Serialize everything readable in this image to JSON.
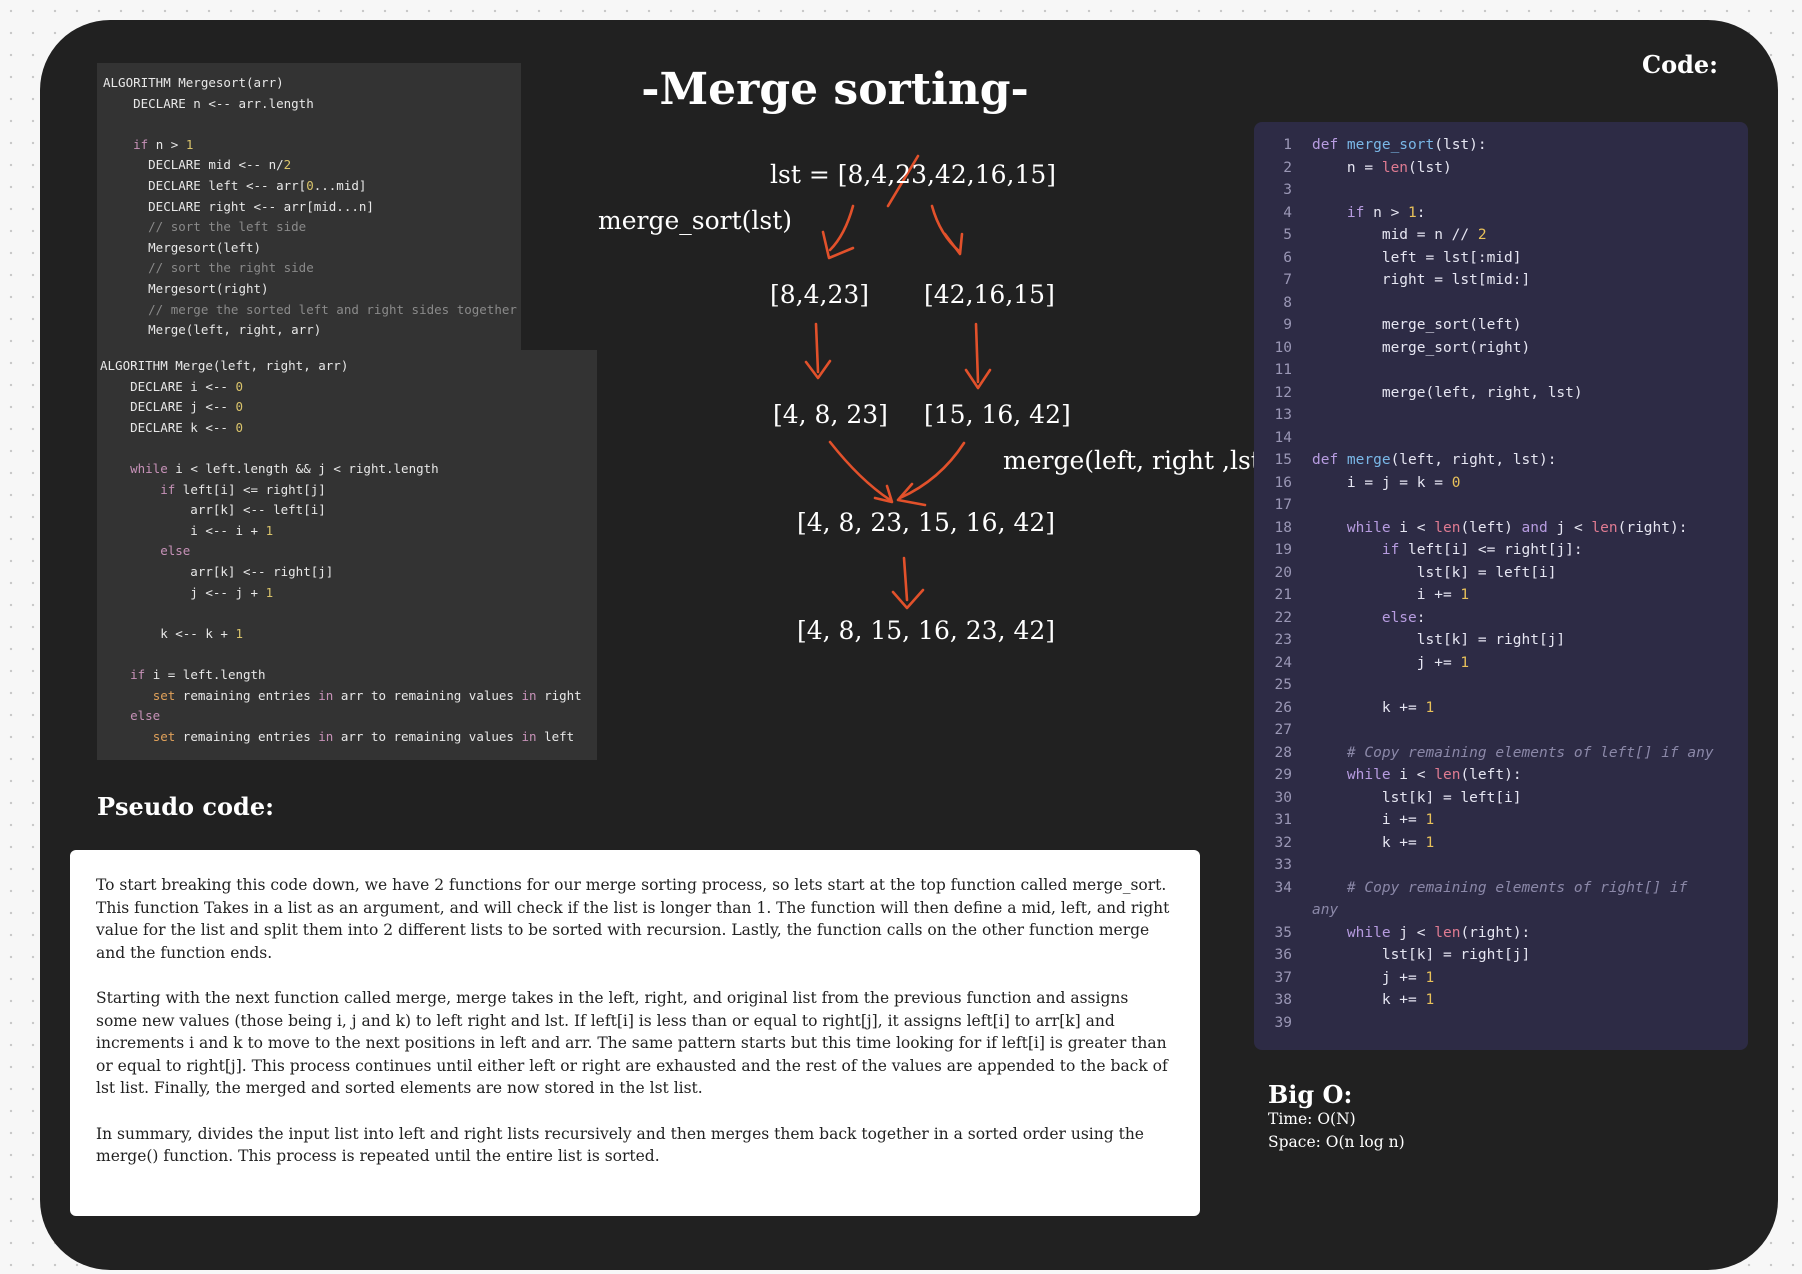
{
  "page": {
    "title": "-Merge sorting-",
    "code_heading": "Code:",
    "pseudo_heading": "Pseudo code:"
  },
  "diagram": {
    "root": "lst = [8,4,23,42,16,15]",
    "merge_sort_label": "merge_sort(lst)",
    "split_left": "[8,4,23]",
    "split_right": "[42,16,15]",
    "sorted_left": "[4, 8, 23]",
    "sorted_right": "[15, 16, 42]",
    "merge_label": "merge(left, right ,lst)",
    "combined": "[4, 8, 23, 15, 16, 42]",
    "result": "[4, 8, 15, 16, 23, 42]",
    "arrow_color": "#e2512b"
  },
  "pseudo_mergesort": [
    [
      [
        "t",
        "ALGORITHM Mergesort(arr)"
      ]
    ],
    [
      [
        "t",
        "    DECLARE n <-- arr.length"
      ]
    ],
    [
      [
        "t",
        ""
      ]
    ],
    [
      [
        "t",
        "    "
      ],
      [
        "kw",
        "if"
      ],
      [
        "t",
        " n > "
      ],
      [
        "num",
        "1"
      ]
    ],
    [
      [
        "t",
        "      DECLARE mid <-- n/"
      ],
      [
        "num",
        "2"
      ]
    ],
    [
      [
        "t",
        "      DECLARE left <-- arr["
      ],
      [
        "num",
        "0"
      ],
      [
        "t",
        "...mid]"
      ]
    ],
    [
      [
        "t",
        "      DECLARE right <-- arr[mid...n]"
      ]
    ],
    [
      [
        "cm",
        "      // sort the left side"
      ]
    ],
    [
      [
        "t",
        "      Mergesort(left)"
      ]
    ],
    [
      [
        "cm",
        "      // sort the right side"
      ]
    ],
    [
      [
        "t",
        "      Mergesort(right)"
      ]
    ],
    [
      [
        "cm",
        "      // merge the sorted left and right sides together"
      ]
    ],
    [
      [
        "t",
        "      Merge(left, right, arr)"
      ]
    ]
  ],
  "pseudo_merge": [
    [
      [
        "t",
        "ALGORITHM Merge(left, right, arr)"
      ]
    ],
    [
      [
        "t",
        "    DECLARE i <-- "
      ],
      [
        "num",
        "0"
      ]
    ],
    [
      [
        "t",
        "    DECLARE j <-- "
      ],
      [
        "num",
        "0"
      ]
    ],
    [
      [
        "t",
        "    DECLARE k <-- "
      ],
      [
        "num",
        "0"
      ]
    ],
    [
      [
        "t",
        ""
      ]
    ],
    [
      [
        "t",
        "    "
      ],
      [
        "kw",
        "while"
      ],
      [
        "t",
        " i < left.length && j < right.length"
      ]
    ],
    [
      [
        "t",
        "        "
      ],
      [
        "kw",
        "if"
      ],
      [
        "t",
        " left[i] <= right[j]"
      ]
    ],
    [
      [
        "t",
        "            arr[k] <-- left[i]"
      ]
    ],
    [
      [
        "t",
        "            i <-- i + "
      ],
      [
        "num",
        "1"
      ]
    ],
    [
      [
        "t",
        "        "
      ],
      [
        "kw",
        "else"
      ]
    ],
    [
      [
        "t",
        "            arr[k] <-- right[j]"
      ]
    ],
    [
      [
        "t",
        "            j <-- j + "
      ],
      [
        "num",
        "1"
      ]
    ],
    [
      [
        "t",
        ""
      ]
    ],
    [
      [
        "t",
        "        k <-- k + "
      ],
      [
        "num",
        "1"
      ]
    ],
    [
      [
        "t",
        ""
      ]
    ],
    [
      [
        "t",
        "    "
      ],
      [
        "kw",
        "if"
      ],
      [
        "t",
        " i = left.length"
      ]
    ],
    [
      [
        "t",
        "       "
      ],
      [
        "st",
        "set"
      ],
      [
        "t",
        " remaining entries "
      ],
      [
        "kw",
        "in"
      ],
      [
        "t",
        " arr to remaining values "
      ],
      [
        "kw",
        "in"
      ],
      [
        "t",
        " right"
      ]
    ],
    [
      [
        "t",
        "    "
      ],
      [
        "kw",
        "else"
      ]
    ],
    [
      [
        "t",
        "       "
      ],
      [
        "st",
        "set"
      ],
      [
        "t",
        " remaining entries "
      ],
      [
        "kw",
        "in"
      ],
      [
        "t",
        " arr to remaining values "
      ],
      [
        "kw",
        "in"
      ],
      [
        "t",
        " left"
      ]
    ]
  ],
  "explanation": [
    "To start breaking this code down, we have 2 functions for our merge sorting process, so lets start at the top function called merge_sort. This function Takes in a list as an argument, and will check if the list is longer than 1. The function will then define a mid, left, and right value for the list and split them into 2 different lists to be sorted with recursion. Lastly, the function calls on the other function merge and the function ends.",
    "Starting with the next function called merge, merge takes in the left, right, and original list from the previous function and assigns some new values  (those being i, j and k) to left right and lst. If left[i] is less than or equal to right[j], it assigns left[i] to arr[k] and increments i and k to move to the next positions in left and arr. The same pattern starts but this time looking for if left[i] is greater than or equal to right[j]. This process continues until either left or right are exhausted and the rest of the values are appended to the back of lst list. Finally, the merged and sorted elements are now stored in the lst list.",
    "In summary, divides the input list into left and right lists recursively and then merges them back together in a sorted order using the merge() function. This process is repeated until the entire list is sorted."
  ],
  "code": [
    {
      "n": "1",
      "parts": [
        [
          "kw",
          "def "
        ],
        [
          "fn",
          "merge_sort"
        ],
        [
          "t",
          "(lst):"
        ]
      ]
    },
    {
      "n": "2",
      "parts": [
        [
          "t",
          "    n = "
        ],
        [
          "bi",
          "len"
        ],
        [
          "t",
          "(lst)"
        ]
      ]
    },
    {
      "n": "3",
      "parts": []
    },
    {
      "n": "4",
      "parts": [
        [
          "t",
          "    "
        ],
        [
          "kw",
          "if"
        ],
        [
          "t",
          " n > "
        ],
        [
          "num",
          "1"
        ],
        [
          "t",
          ":"
        ]
      ]
    },
    {
      "n": "5",
      "parts": [
        [
          "t",
          "        mid = n // "
        ],
        [
          "num",
          "2"
        ]
      ]
    },
    {
      "n": "6",
      "parts": [
        [
          "t",
          "        left = lst[:mid]"
        ]
      ]
    },
    {
      "n": "7",
      "parts": [
        [
          "t",
          "        right = lst[mid:]"
        ]
      ]
    },
    {
      "n": "8",
      "parts": []
    },
    {
      "n": "9",
      "parts": [
        [
          "t",
          "        merge_sort(left)"
        ]
      ]
    },
    {
      "n": "10",
      "parts": [
        [
          "t",
          "        merge_sort(right)"
        ]
      ]
    },
    {
      "n": "11",
      "parts": []
    },
    {
      "n": "12",
      "parts": [
        [
          "t",
          "        merge(left, right, lst)"
        ]
      ]
    },
    {
      "n": "13",
      "parts": []
    },
    {
      "n": "14",
      "parts": []
    },
    {
      "n": "15",
      "parts": [
        [
          "kw",
          "def "
        ],
        [
          "fn",
          "merge"
        ],
        [
          "t",
          "(left, right, lst):"
        ]
      ]
    },
    {
      "n": "16",
      "parts": [
        [
          "t",
          "    i = j = k = "
        ],
        [
          "num",
          "0"
        ]
      ]
    },
    {
      "n": "17",
      "parts": []
    },
    {
      "n": "18",
      "parts": [
        [
          "t",
          "    "
        ],
        [
          "kw",
          "while"
        ],
        [
          "t",
          " i < "
        ],
        [
          "bi",
          "len"
        ],
        [
          "t",
          "(left) "
        ],
        [
          "kw",
          "and"
        ],
        [
          "t",
          " j < "
        ],
        [
          "bi",
          "len"
        ],
        [
          "t",
          "(right):"
        ]
      ]
    },
    {
      "n": "19",
      "parts": [
        [
          "t",
          "        "
        ],
        [
          "kw",
          "if"
        ],
        [
          "t",
          " left[i] <= right[j]:"
        ]
      ]
    },
    {
      "n": "20",
      "parts": [
        [
          "t",
          "            lst[k] = left[i]"
        ]
      ]
    },
    {
      "n": "21",
      "parts": [
        [
          "t",
          "            i += "
        ],
        [
          "num",
          "1"
        ]
      ]
    },
    {
      "n": "22",
      "parts": [
        [
          "t",
          "        "
        ],
        [
          "kw",
          "else"
        ],
        [
          "t",
          ":"
        ]
      ]
    },
    {
      "n": "23",
      "parts": [
        [
          "t",
          "            lst[k] = right[j]"
        ]
      ]
    },
    {
      "n": "24",
      "parts": [
        [
          "t",
          "            j += "
        ],
        [
          "num",
          "1"
        ]
      ]
    },
    {
      "n": "25",
      "parts": []
    },
    {
      "n": "26",
      "parts": [
        [
          "t",
          "        k += "
        ],
        [
          "num",
          "1"
        ]
      ]
    },
    {
      "n": "27",
      "parts": []
    },
    {
      "n": "28",
      "parts": [
        [
          "t",
          "    "
        ],
        [
          "cm",
          "# Copy remaining elements of left[] if any"
        ]
      ]
    },
    {
      "n": "29",
      "parts": [
        [
          "t",
          "    "
        ],
        [
          "kw",
          "while"
        ],
        [
          "t",
          " i < "
        ],
        [
          "bi",
          "len"
        ],
        [
          "t",
          "(left):"
        ]
      ]
    },
    {
      "n": "30",
      "parts": [
        [
          "t",
          "        lst[k] = left[i]"
        ]
      ]
    },
    {
      "n": "31",
      "parts": [
        [
          "t",
          "        i += "
        ],
        [
          "num",
          "1"
        ]
      ]
    },
    {
      "n": "32",
      "parts": [
        [
          "t",
          "        k += "
        ],
        [
          "num",
          "1"
        ]
      ]
    },
    {
      "n": "33",
      "parts": []
    },
    {
      "n": "34",
      "parts": [
        [
          "t",
          "    "
        ],
        [
          "cm",
          "# Copy remaining elements of right[] if"
        ]
      ]
    },
    {
      "n": "",
      "parts": [
        [
          "cm",
          "any"
        ]
      ]
    },
    {
      "n": "35",
      "parts": [
        [
          "t",
          "    "
        ],
        [
          "kw",
          "while"
        ],
        [
          "t",
          " j < "
        ],
        [
          "bi",
          "len"
        ],
        [
          "t",
          "(right):"
        ]
      ]
    },
    {
      "n": "36",
      "parts": [
        [
          "t",
          "        lst[k] = right[j]"
        ]
      ]
    },
    {
      "n": "37",
      "parts": [
        [
          "t",
          "        j += "
        ],
        [
          "num",
          "1"
        ]
      ]
    },
    {
      "n": "38",
      "parts": [
        [
          "t",
          "        k += "
        ],
        [
          "num",
          "1"
        ]
      ]
    },
    {
      "n": "39",
      "parts": []
    }
  ],
  "bigo": {
    "title": "Big O:",
    "time": "Time: O(N)",
    "space": "Space: O(n log n)"
  }
}
